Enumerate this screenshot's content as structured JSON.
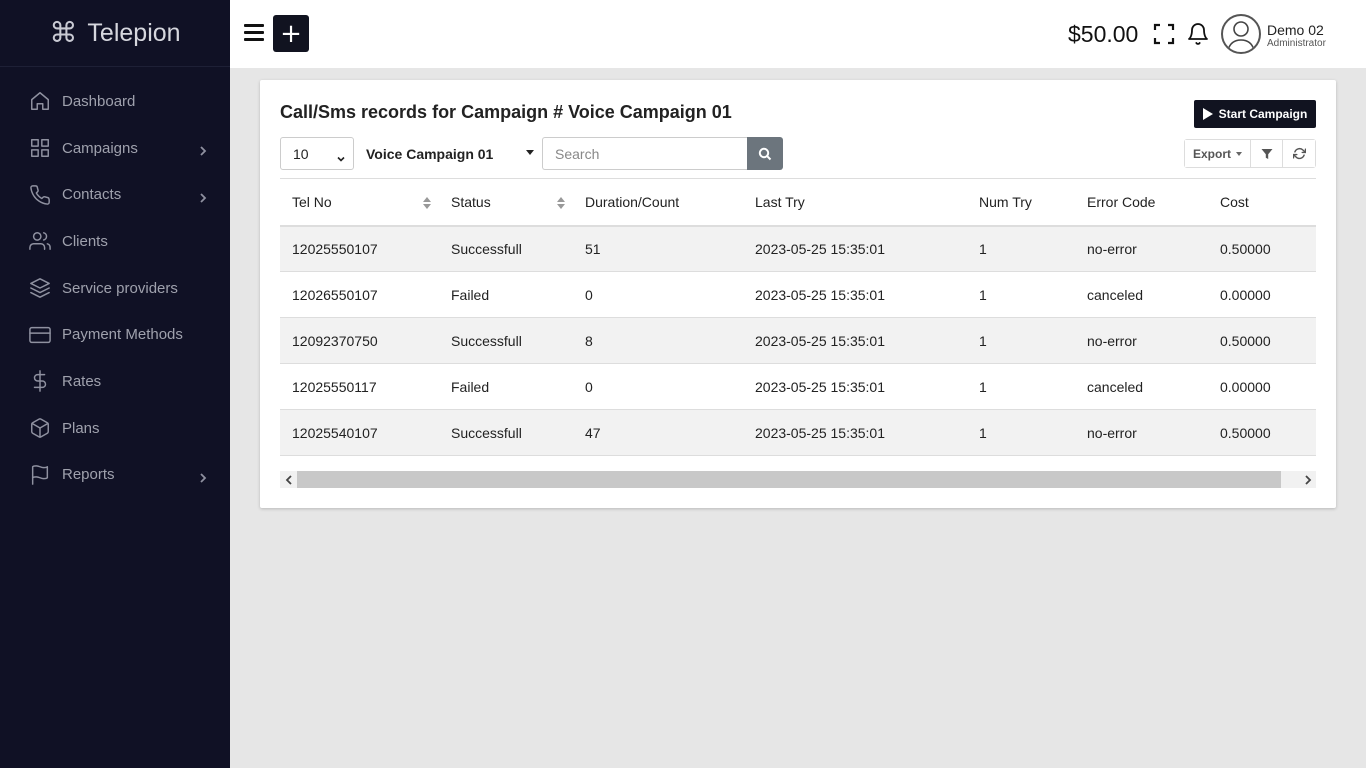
{
  "brand": {
    "name": "Telepion",
    "icon": "command-icon"
  },
  "sidebar": {
    "items": [
      {
        "label": "Dashboard",
        "icon": "home-icon",
        "has_children": false
      },
      {
        "label": "Campaigns",
        "icon": "grid-icon",
        "has_children": true
      },
      {
        "label": "Contacts",
        "icon": "phone-icon",
        "has_children": true
      },
      {
        "label": "Clients",
        "icon": "users-icon",
        "has_children": false
      },
      {
        "label": "Service providers",
        "icon": "layers-icon",
        "has_children": false
      },
      {
        "label": "Payment Methods",
        "icon": "credit-card-icon",
        "has_children": false
      },
      {
        "label": "Rates",
        "icon": "dollar-icon",
        "has_children": false
      },
      {
        "label": "Plans",
        "icon": "box-icon",
        "has_children": false
      },
      {
        "label": "Reports",
        "icon": "flag-icon",
        "has_children": true
      }
    ]
  },
  "header": {
    "add_label": "+",
    "balance": "$50.00",
    "user": {
      "name": "Demo 02",
      "role": "Administrator"
    }
  },
  "main": {
    "title": "Call/Sms records for Campaign # Voice Campaign 01",
    "start_label": "Start Campaign",
    "page_size": "10",
    "campaign": "Voice Campaign 01",
    "search_placeholder": "Search",
    "export_label": "Export",
    "columns": [
      "Tel No",
      "Status",
      "Duration/Count",
      "Last Try",
      "Num Try",
      "Error Code",
      "Cost"
    ],
    "rows": [
      [
        "12025550107",
        "Successfull",
        "51",
        "2023-05-25 15:35:01",
        "1",
        "no-error",
        "0.50000"
      ],
      [
        "12026550107",
        "Failed",
        "0",
        "2023-05-25 15:35:01",
        "1",
        "canceled",
        "0.00000"
      ],
      [
        "12092370750",
        "Successfull",
        "8",
        "2023-05-25 15:35:01",
        "1",
        "no-error",
        "0.50000"
      ],
      [
        "12025550117",
        "Failed",
        "0",
        "2023-05-25 15:35:01",
        "1",
        "canceled",
        "0.00000"
      ],
      [
        "12025540107",
        "Successfull",
        "47",
        "2023-05-25 15:35:01",
        "1",
        "no-error",
        "0.50000"
      ]
    ]
  },
  "colors": {
    "sidebar_bg": "#101125",
    "accent_dark": "#111320",
    "search_button": "#6c757d",
    "page_bg": "#e6e6e6"
  }
}
